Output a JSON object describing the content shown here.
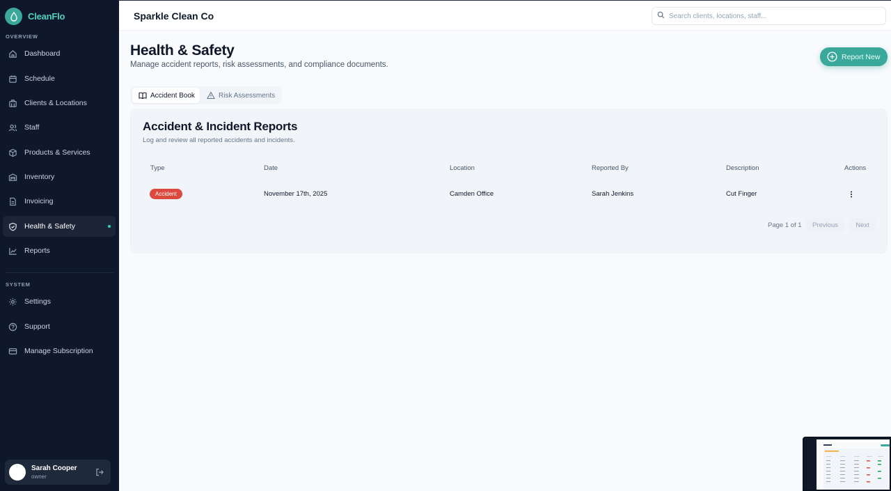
{
  "app": {
    "name": "CleanFlo"
  },
  "sidebar": {
    "overview_label": "OVERVIEW",
    "system_label": "SYSTEM",
    "items": [
      {
        "label": "Dashboard",
        "icon": "home-icon"
      },
      {
        "label": "Schedule",
        "icon": "calendar-icon"
      },
      {
        "label": "Clients & Locations",
        "icon": "building-icon"
      },
      {
        "label": "Staff",
        "icon": "users-icon"
      },
      {
        "label": "Products & Services",
        "icon": "box-icon"
      },
      {
        "label": "Inventory",
        "icon": "warehouse-icon"
      },
      {
        "label": "Invoicing",
        "icon": "file-text-icon"
      },
      {
        "label": "Health & Safety",
        "icon": "shield-check-icon",
        "active": true
      },
      {
        "label": "Reports",
        "icon": "line-chart-icon"
      }
    ],
    "system_items": [
      {
        "label": "Settings",
        "icon": "gear-icon"
      },
      {
        "label": "Support",
        "icon": "help-circle-icon"
      },
      {
        "label": "Manage Subscription",
        "icon": "credit-card-icon"
      }
    ],
    "user": {
      "name": "Sarah Cooper",
      "role": "owner"
    }
  },
  "topbar": {
    "company": "Sparkle Clean Co",
    "search_placeholder": "Search clients, locations, staff..."
  },
  "page": {
    "title": "Health & Safety",
    "subtitle": "Manage accident reports, risk assessments, and compliance documents.",
    "report_button": "Report New"
  },
  "tabs": [
    {
      "label": "Accident Book",
      "active": true,
      "icon": "book-icon"
    },
    {
      "label": "Risk Assessments",
      "active": false,
      "icon": "warning-triangle-icon"
    }
  ],
  "card": {
    "title": "Accident & Incident Reports",
    "subtitle": "Log and review all reported accidents and incidents.",
    "columns": [
      "Type",
      "Date",
      "Location",
      "Reported By",
      "Description",
      "Actions"
    ],
    "rows": [
      {
        "type": "Accident",
        "date": "November 17th, 2025",
        "location": "Camden Office",
        "reported_by": "Sarah Jenkins",
        "description": "Cut Finger"
      }
    ],
    "pagination": {
      "text": "Page 1 of 1",
      "previous": "Previous",
      "next": "Next"
    }
  },
  "colors": {
    "accent": "#3aa89a",
    "sidebar_bg": "#0f172a",
    "badge_red": "#dc4a3f"
  }
}
